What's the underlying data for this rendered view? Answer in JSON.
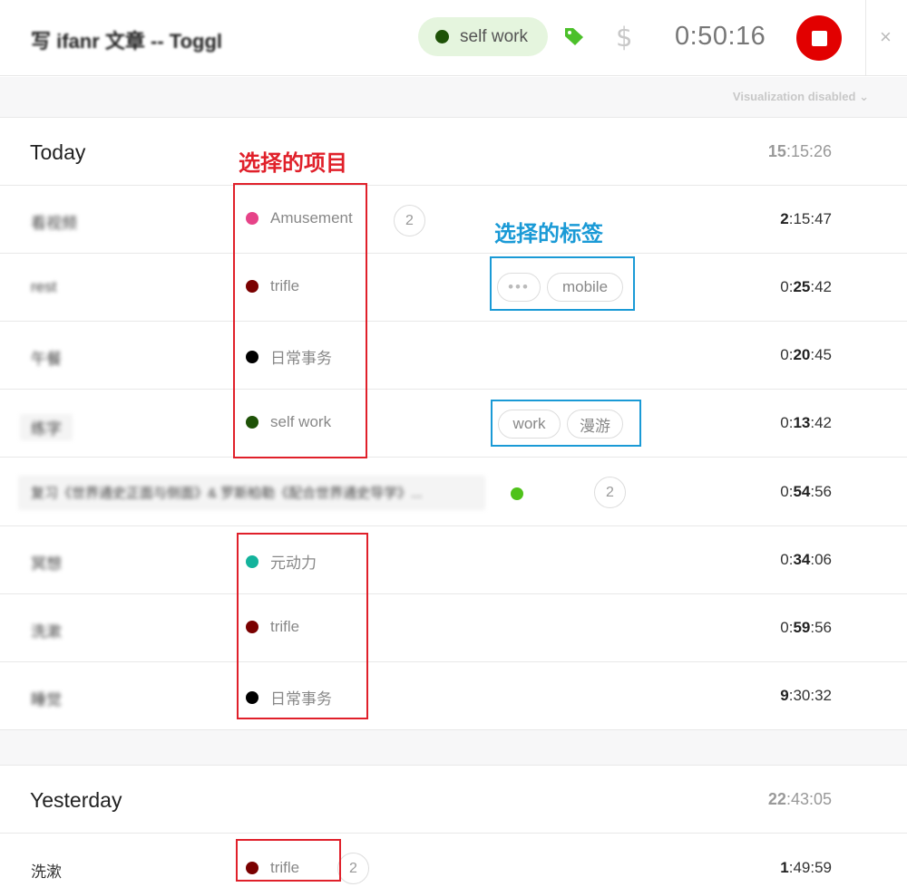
{
  "header": {
    "description": "写 ifanr 文章 -- Toggl",
    "project": {
      "name": "self work",
      "color": "#1e5207"
    },
    "tag_icon": "tag-icon",
    "billable_icon": "dollar-icon",
    "billable_symbol": "$",
    "timer": "0:50:16",
    "stop_icon": "stop-icon",
    "close_symbol": "×"
  },
  "visualization": {
    "label": "Visualization disabled",
    "chevron": "⌄"
  },
  "today": {
    "name": "Today",
    "total_hours": "15",
    "total_rest": ":15:26",
    "entries": [
      {
        "description": "看视频",
        "project": "Amusement",
        "color": "#e64388",
        "count": "2",
        "tags": [],
        "dur_pre": "",
        "dur_bold": "2",
        "dur_post": ":15:47"
      },
      {
        "description": "rest",
        "project": "trifle",
        "color": "#7a0000",
        "count": "",
        "tags": [
          "•••",
          "mobile"
        ],
        "dur_pre": "0:",
        "dur_bold": "25",
        "dur_post": ":42"
      },
      {
        "description": "午餐",
        "project": "日常事务",
        "color": "#000000",
        "count": "",
        "tags": [],
        "dur_pre": "0:",
        "dur_bold": "20",
        "dur_post": ":45"
      },
      {
        "description": "练字",
        "project": "self work",
        "color": "#1e5207",
        "count": "",
        "tags": [
          "work",
          "漫游"
        ],
        "dur_pre": "0:",
        "dur_bold": "13",
        "dur_post": ":42"
      },
      {
        "description": "复习《世界通史正面与侧面》& 罗斯柏勒《配合世界通史导学》...",
        "project": "",
        "color": "#4fc21a",
        "count": "2",
        "tags": [],
        "dur_pre": "0:",
        "dur_bold": "54",
        "dur_post": ":56"
      },
      {
        "description": "冥想",
        "project": "元动力",
        "color": "#13b39c",
        "count": "",
        "tags": [],
        "dur_pre": "0:",
        "dur_bold": "34",
        "dur_post": ":06"
      },
      {
        "description": "洗漱",
        "project": "trifle",
        "color": "#7a0000",
        "count": "",
        "tags": [],
        "dur_pre": "0:",
        "dur_bold": "59",
        "dur_post": ":56"
      },
      {
        "description": "睡觉",
        "project": "日常事务",
        "color": "#000000",
        "count": "",
        "tags": [],
        "dur_pre": "",
        "dur_bold": "9",
        "dur_post": ":30:32"
      }
    ]
  },
  "yesterday": {
    "name": "Yesterday",
    "total_hours": "22",
    "total_rest": ":43:05",
    "entries": [
      {
        "description": "洗漱",
        "project": "trifle",
        "color": "#7a0000",
        "count": "2",
        "dur_pre": "",
        "dur_bold": "1",
        "dur_post": ":49:59"
      }
    ]
  },
  "annotations": {
    "project_label": "选择的项目",
    "project_color": "#e0202a",
    "tag_label": "选择的标签",
    "tag_color": "#1a9ad6"
  }
}
